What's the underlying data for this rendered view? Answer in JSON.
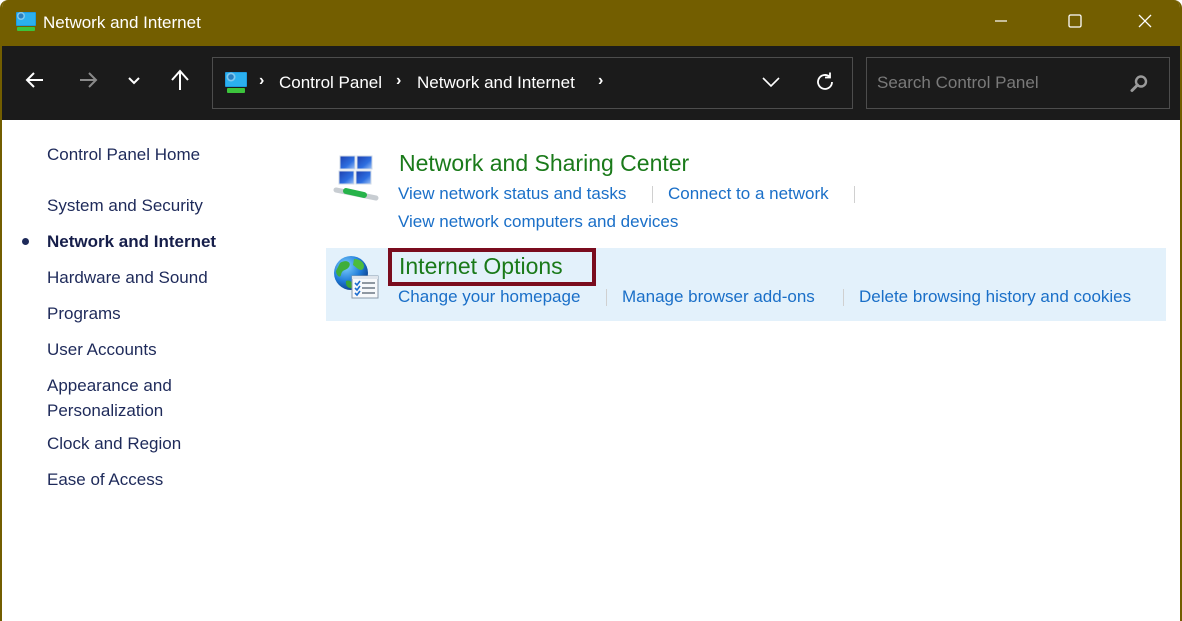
{
  "window": {
    "title": "Network and Internet",
    "app_icon": "control-panel-icon",
    "controls": {
      "minimize_icon": "minimize-icon",
      "maximize_icon": "maximize-icon",
      "close_icon": "close-icon"
    },
    "frame_color": "#735e00"
  },
  "navbar": {
    "back_icon": "arrow-left-icon",
    "forward_icon": "arrow-right-icon",
    "recent_icon": "chevron-down-icon",
    "up_icon": "arrow-up-icon",
    "breadcrumb": [
      {
        "label": "Control Panel"
      },
      {
        "label": "Network and Internet"
      }
    ],
    "separator": "›",
    "refresh_icon": "refresh-icon",
    "search": {
      "placeholder": "Search Control Panel",
      "value": ""
    }
  },
  "sidebar": {
    "home": "Control Panel Home",
    "items": [
      {
        "label": "System and Security",
        "active": false
      },
      {
        "label": "Network and Internet",
        "active": true
      },
      {
        "label": "Hardware and Sound",
        "active": false
      },
      {
        "label": "Programs",
        "active": false
      },
      {
        "label": "User Accounts",
        "active": false
      },
      {
        "label": "Appearance and Personalization",
        "lines": [
          "Appearance and",
          "Personalization"
        ],
        "active": false
      },
      {
        "label": "Clock and Region",
        "active": false
      },
      {
        "label": "Ease of Access",
        "active": false
      }
    ]
  },
  "main": {
    "categories": [
      {
        "title": "Network and Sharing Center",
        "icon": "network-sharing-icon",
        "links": [
          "View network status and tasks",
          "Connect to a network",
          "View network computers and devices"
        ]
      },
      {
        "title": "Internet Options",
        "icon": "internet-options-icon",
        "highlighted": true,
        "links": [
          "Change your homepage",
          "Manage browser add-ons",
          "Delete browsing history and cookies"
        ]
      }
    ]
  },
  "colors": {
    "title_green": "#1a7a1a",
    "link_blue": "#1a6fc8",
    "sidebar_text": "#1e2a5a",
    "highlight_border": "#7a0c1e",
    "selected_bg": "#e3f1fb"
  }
}
